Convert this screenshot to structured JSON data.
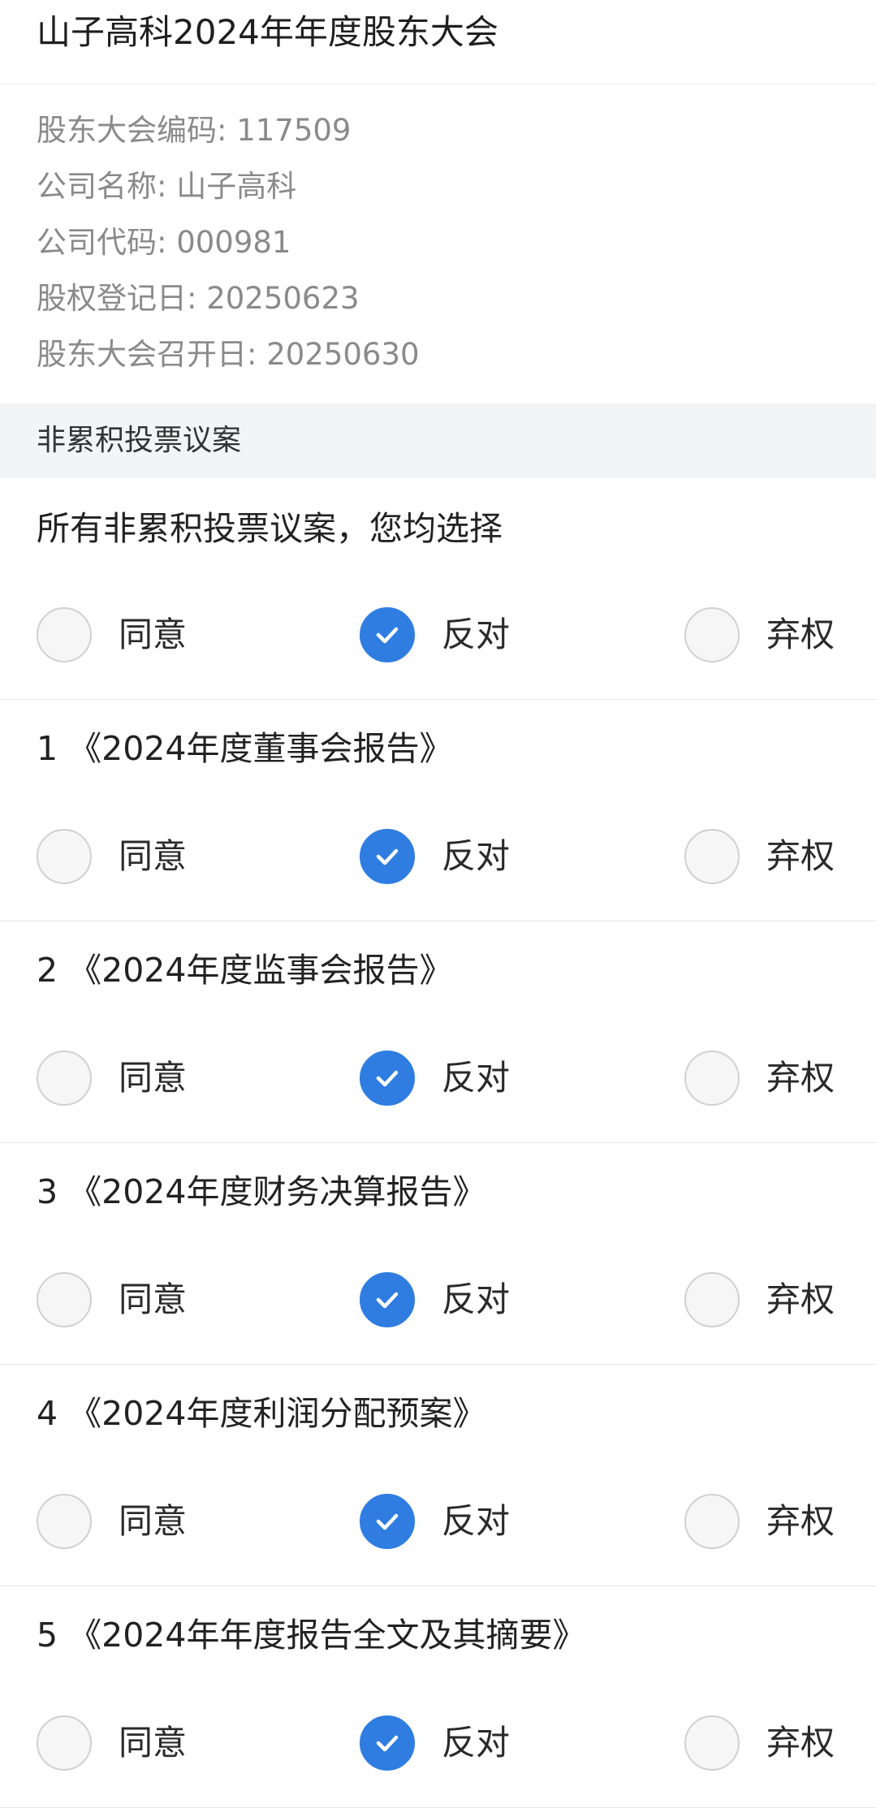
{
  "header": {
    "title": "山子高科2024年年度股东大会"
  },
  "info": [
    "股东大会编码: 117509",
    "公司名称: 山子高科",
    "公司代码: 000981",
    "股权登记日: 20250623",
    "股东大会召开日: 20250630"
  ],
  "section": {
    "title": "非累积投票议案"
  },
  "options": {
    "agree": "同意",
    "oppose": "反对",
    "abstain": "弃权"
  },
  "all_choice": {
    "title": "所有非累积投票议案，您均选择",
    "selected": "反对"
  },
  "proposals": [
    {
      "title": "1 《2024年度董事会报告》",
      "selected": "反对"
    },
    {
      "title": "2 《2024年度监事会报告》",
      "selected": "反对"
    },
    {
      "title": "3 《2024年度财务决算报告》",
      "selected": "反对"
    },
    {
      "title": "4 《2024年度利润分配预案》",
      "selected": "反对"
    },
    {
      "title": "5 《2024年年度报告全文及其摘要》",
      "selected": "反对"
    }
  ],
  "colors": {
    "accent": "#2f7de1"
  },
  "icons": {
    "checked": "check-icon"
  }
}
